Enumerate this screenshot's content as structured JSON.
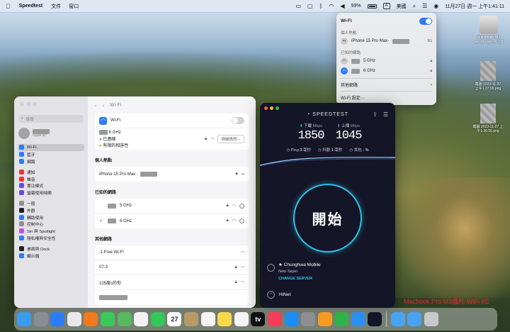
{
  "menubar": {
    "app": "Speedtest",
    "items": [
      "文件",
      "窗口"
    ],
    "battery": "99%",
    "ime_badge": "A",
    "ime": "美國",
    "clock": "11月27日 週一 上午1:41:11"
  },
  "wifi_menu": {
    "title": "Wi-Fi",
    "hotspot_label": "個人熱點",
    "hotspot_name": "iPhone 15 Pro Max-",
    "hotspot_signal": "5G",
    "known_label": "已知的網路",
    "known": [
      {
        "name": "5 GHz"
      },
      {
        "name": "6 GHz"
      }
    ],
    "other_label": "其他網路",
    "settings_label": "Wi-Fi 設定⋯"
  },
  "desktop": {
    "hd_name": "Macintosh HD",
    "hd_sub": "965 GB・968 GB 可用",
    "files": [
      {
        "line1": "截圖 2023-11-27",
        "line2": "上午1.37.55.png"
      },
      {
        "line1": "截圖 2023-11-27 上",
        "line2": "午1.36.56.png"
      }
    ]
  },
  "settings": {
    "title": "Wi-Fi",
    "search_placeholder": "搜尋",
    "user_sub": "Apple ID",
    "sidebar": [
      {
        "label": "Wi-Fi",
        "color": "#2d7cf6",
        "selected": true
      },
      {
        "label": "藍牙",
        "color": "#2d7cf6"
      },
      {
        "label": "網路",
        "color": "#2d7cf6"
      },
      {
        "gap": true
      },
      {
        "label": "通知",
        "color": "#e5373b"
      },
      {
        "label": "聲音",
        "color": "#e5373b"
      },
      {
        "label": "專注模式",
        "color": "#6a4bd6"
      },
      {
        "label": "螢幕使用時間",
        "color": "#6a4bd6"
      },
      {
        "gap": true
      },
      {
        "label": "一般",
        "color": "#8e8e93"
      },
      {
        "label": "外觀",
        "color": "#222222"
      },
      {
        "label": "輔助使用",
        "color": "#2d7cf6"
      },
      {
        "label": "控制中心",
        "color": "#8e8e93"
      },
      {
        "label": "Siri 與 Spotlight",
        "color": "#c24de0"
      },
      {
        "label": "隱私權與安全性",
        "color": "#2d7cf6"
      },
      {
        "gap": true
      },
      {
        "label": "桌面與 Dock",
        "color": "#222222"
      },
      {
        "label": "顯示器",
        "color": "#2d7cf6"
      }
    ],
    "wifi_label": "Wi-Fi",
    "connected_name": "6 GHz",
    "status_connected": "已連線",
    "status_warning": "有限的相容性",
    "details_button": "詳細資訊⋯",
    "hotspot_section": "個人熱點",
    "hotspot_name": "iPhone 15 Pro Max-",
    "known_section": "已知的網路",
    "known": [
      {
        "name": "5 GHz",
        "check": ""
      },
      {
        "name": "6 GHz",
        "check": "✓"
      }
    ],
    "other_section": "其他網路",
    "others": [
      {
        "name": ".1.Free Wi-Fi",
        "lock": false
      },
      {
        "name": "07-3",
        "lock": true
      },
      {
        "name": "105度c的你",
        "lock": true
      }
    ]
  },
  "speedtest": {
    "logo": "SPEEDTEST",
    "download_label": "下載",
    "upload_label": "上傳",
    "unit": "Mbps",
    "download": "1850",
    "upload": "1045",
    "ping_label": "Ping",
    "ping": "3",
    "jitter_label": "抖動",
    "jitter": "1",
    "loss_label": "丟包",
    "loss": "- %",
    "ms": "毫秒",
    "start": "開始",
    "isp": "Chunghwa Mobile",
    "city": "New Taipei",
    "change_server": "CHANGE SERVER",
    "network": "HiNet"
  },
  "caption": "Macbook Pro M3晶片-WiFi 6E",
  "dock": [
    {
      "name": "finder",
      "color": "#3b9cf0"
    },
    {
      "name": "launchpad",
      "color": "#8c8c96"
    },
    {
      "name": "safari",
      "color": "#2d7cf6"
    },
    {
      "name": "chrome",
      "color": "#e9e9e9"
    },
    {
      "name": "firefox",
      "color": "#f07a1e"
    },
    {
      "name": "messages",
      "color": "#3bc95a"
    },
    {
      "name": "maps",
      "color": "#58b95e"
    },
    {
      "name": "photos",
      "color": "#f2f2f2"
    },
    {
      "name": "facetime",
      "color": "#34c759"
    },
    {
      "name": "calendar",
      "color": "#ffffff",
      "text": "27"
    },
    {
      "name": "contacts",
      "color": "#b89a6a"
    },
    {
      "name": "reminders",
      "color": "#f4f4f4"
    },
    {
      "name": "notes",
      "color": "#f8d94b"
    },
    {
      "name": "freeform",
      "color": "#f4f4f4"
    },
    {
      "name": "tv",
      "color": "#111111",
      "text": "tv"
    },
    {
      "name": "music",
      "color": "#f23e58"
    },
    {
      "name": "app-store",
      "color": "#1e8ef2"
    },
    {
      "name": "system-settings",
      "color": "#8e8e93"
    },
    {
      "name": "pages",
      "color": "#f49b25"
    },
    {
      "name": "numbers",
      "color": "#2fb24a"
    },
    {
      "name": "xcode",
      "color": "#2b8ff0"
    },
    {
      "name": "speedtest",
      "color": "#141527"
    },
    {
      "sep": true
    },
    {
      "name": "downloads-folder",
      "color": "#4aa3f0"
    },
    {
      "name": "applications-folder",
      "color": "#4aa3f0"
    },
    {
      "name": "trash",
      "color": "#c9c9cc"
    }
  ]
}
